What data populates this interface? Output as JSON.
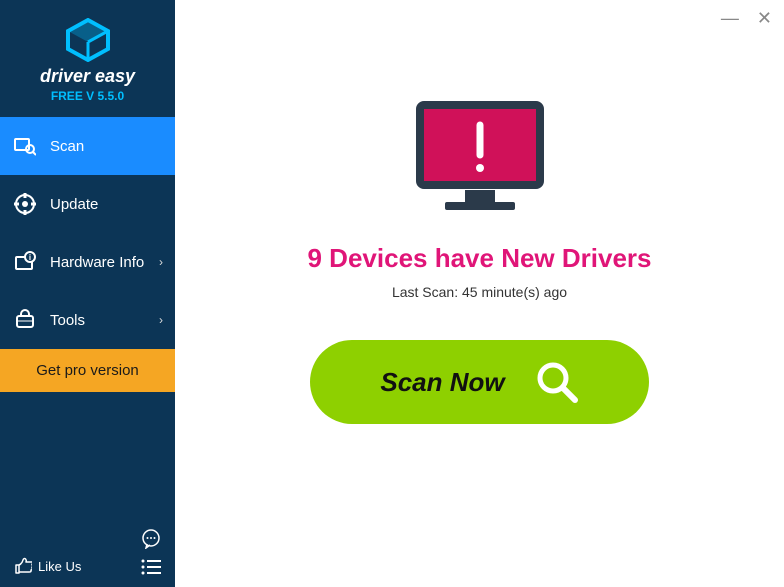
{
  "brand": "driver easy",
  "version": "FREE V 5.5.0",
  "nav": {
    "scan": "Scan",
    "update": "Update",
    "hardware": "Hardware Info",
    "tools": "Tools"
  },
  "pro_button": "Get pro version",
  "like_us": "Like Us",
  "main": {
    "headline": "9 Devices have New Drivers",
    "subline": "Last Scan: 45 minute(s) ago",
    "scan_button": "Scan Now"
  },
  "colors": {
    "accent_pink": "#e01578",
    "accent_green": "#8ed000",
    "sidebar_bg": "#0c3556",
    "active_bg": "#1a8cff",
    "pro_bg": "#f5a623"
  }
}
